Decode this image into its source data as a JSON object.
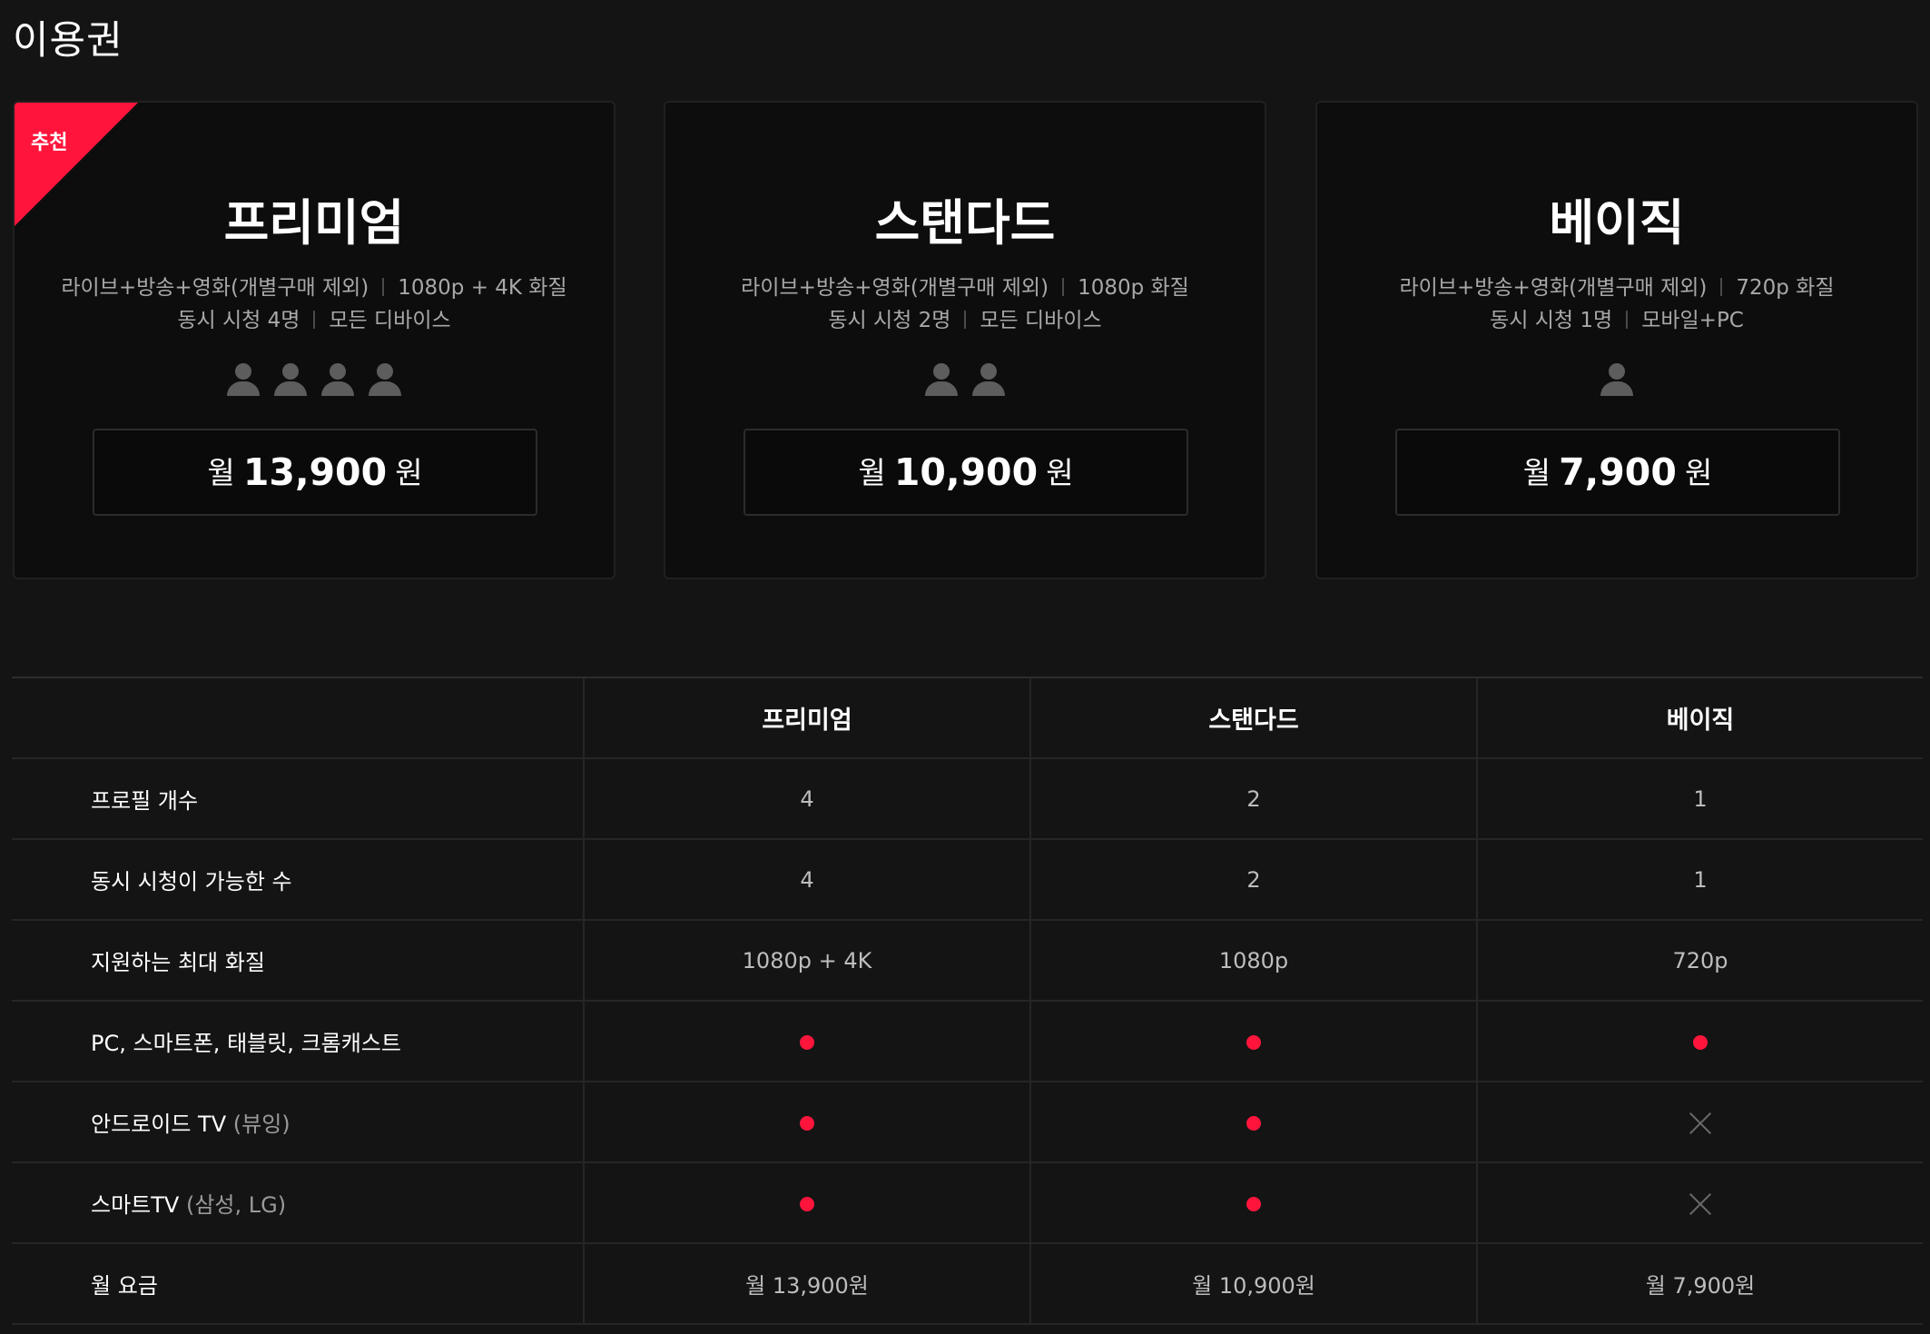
{
  "page": {
    "title": "이용권"
  },
  "colors": {
    "accent": "#ff153c",
    "background": "#141414",
    "card": "#0d0d0d"
  },
  "plans": [
    {
      "badge": "추천",
      "name": "프리미엄",
      "content": "라이브+방송+영화(개별구매 제외)",
      "quality": "1080p + 4K 화질",
      "streams": "동시 시청 4명",
      "devices": "모든 디바이스",
      "user_count": 4,
      "price_prefix": "월",
      "price_amount": "13,900",
      "price_suffix": "원"
    },
    {
      "name": "스탠다드",
      "content": "라이브+방송+영화(개별구매 제외)",
      "quality": "1080p 화질",
      "streams": "동시 시청 2명",
      "devices": "모든 디바이스",
      "user_count": 2,
      "price_prefix": "월",
      "price_amount": "10,900",
      "price_suffix": "원"
    },
    {
      "name": "베이직",
      "content": "라이브+방송+영화(개별구매 제외)",
      "quality": "720p 화질",
      "streams": "동시 시청 1명",
      "devices": "모바일+PC",
      "user_count": 1,
      "price_prefix": "월",
      "price_amount": "7,900",
      "price_suffix": "원"
    }
  ],
  "comparison": {
    "headers": [
      "",
      "프리미엄",
      "스탠다드",
      "베이직"
    ],
    "rows": [
      {
        "label": "프로필 개수",
        "sub": "",
        "values": [
          "4",
          "2",
          "1"
        ]
      },
      {
        "label": "동시 시청이 가능한 수",
        "sub": "",
        "values": [
          "4",
          "2",
          "1"
        ]
      },
      {
        "label": "지원하는 최대 화질",
        "sub": "",
        "values": [
          "1080p + 4K",
          "1080p",
          "720p"
        ]
      },
      {
        "label": "PC, 스마트폰, 태블릿, 크롬캐스트",
        "sub": "",
        "values": [
          "dot-icon",
          "dot-icon",
          "dot-icon"
        ]
      },
      {
        "label": "안드로이드 TV",
        "sub": "(뷰잉)",
        "values": [
          "dot-icon",
          "dot-icon",
          "x-icon"
        ]
      },
      {
        "label": "스마트TV",
        "sub": "(삼성, LG)",
        "values": [
          "dot-icon",
          "dot-icon",
          "x-icon"
        ]
      },
      {
        "label": "월 요금",
        "sub": "",
        "values": [
          "월 13,900원",
          "월 10,900원",
          "월 7,900원"
        ]
      }
    ]
  }
}
